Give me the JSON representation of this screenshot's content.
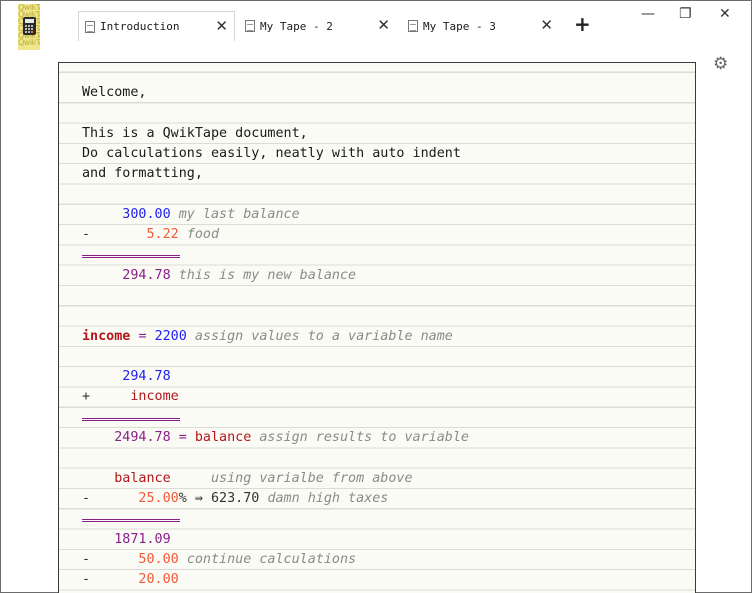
{
  "tabs": [
    {
      "label": "Introduction"
    },
    {
      "label": "My Tape - 2"
    },
    {
      "label": "My Tape - 3"
    }
  ],
  "icons": {
    "close": "✕",
    "add": "+",
    "minimize": "—",
    "maximize": "❐",
    "settings": "⚙"
  },
  "app_icon_text": "QwikTape\nQwikTape\nQwikTape\nQwikTape\nQwikTape\nQwikTape",
  "doc": {
    "l1": "Welcome,",
    "l3": "This is a QwikTape document,",
    "l4": "Do calculations easily, neatly with auto indent",
    "l5": "and formatting,",
    "l7_num": "     300.00",
    "l7_cmt": "my last balance",
    "l8_op": "-",
    "l8_num": "       5.22",
    "l8_cmt": "food",
    "l10_num": "     294.78",
    "l10_cmt": "this is my new balance",
    "l13_var": "income",
    "l13_eq": "=",
    "l13_num": "2200",
    "l13_cmt": "assign values to a variable name",
    "l15_num": "     294.78",
    "l16_op": "+",
    "l16_var": "     income",
    "l18_num": "    2494.78",
    "l18_eq": "=",
    "l18_var": "balance",
    "l18_cmt": "assign results to variable",
    "l20_var": "    balance",
    "l20_cmt": "using varialbe from above",
    "l21_op": "-",
    "l21_num": "      25.00",
    "l21_pct": "%",
    "l21_arrow": "⇛",
    "l21_res": "623.70",
    "l21_cmt": "damn high taxes",
    "l23_num": "    1871.09",
    "l24_op": "-",
    "l24_num": "      50.00",
    "l24_cmt": "continue calculations",
    "l25_op": "-",
    "l25_num": "      20.00"
  }
}
